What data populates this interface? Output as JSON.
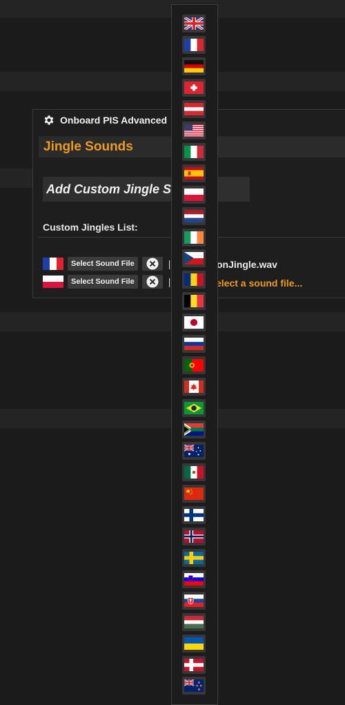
{
  "panel": {
    "title": "Onboard PIS Advanced",
    "section_title": "Jingle Sounds",
    "add_button_label": "Add Custom Jingle Sounds",
    "list_label": "Custom Jingles List:"
  },
  "jingles": [
    {
      "flag": "fr-flag-icon",
      "select_label": "Select Sound File",
      "separator": "|",
      "file": "onJingle.wav"
    },
    {
      "flag": "pl-flag-icon",
      "select_label": "Select Sound File",
      "separator": "|",
      "file": "elect a sound file..."
    }
  ],
  "colors": {
    "accent": "#ef9b1f",
    "panel_bg": "#1e1e1e",
    "page_bg": "#1b1b1b"
  },
  "flag_menu": {
    "items": [
      "gb",
      "fr",
      "de",
      "ch",
      "at",
      "us",
      "it",
      "es",
      "pl",
      "nl",
      "ie",
      "cz",
      "ro",
      "be",
      "jp",
      "ru",
      "pt",
      "ca",
      "br",
      "za",
      "au",
      "mx",
      "cn",
      "fi",
      "no",
      "se",
      "si",
      "sk",
      "hu",
      "ua",
      "dk",
      "nz"
    ]
  }
}
